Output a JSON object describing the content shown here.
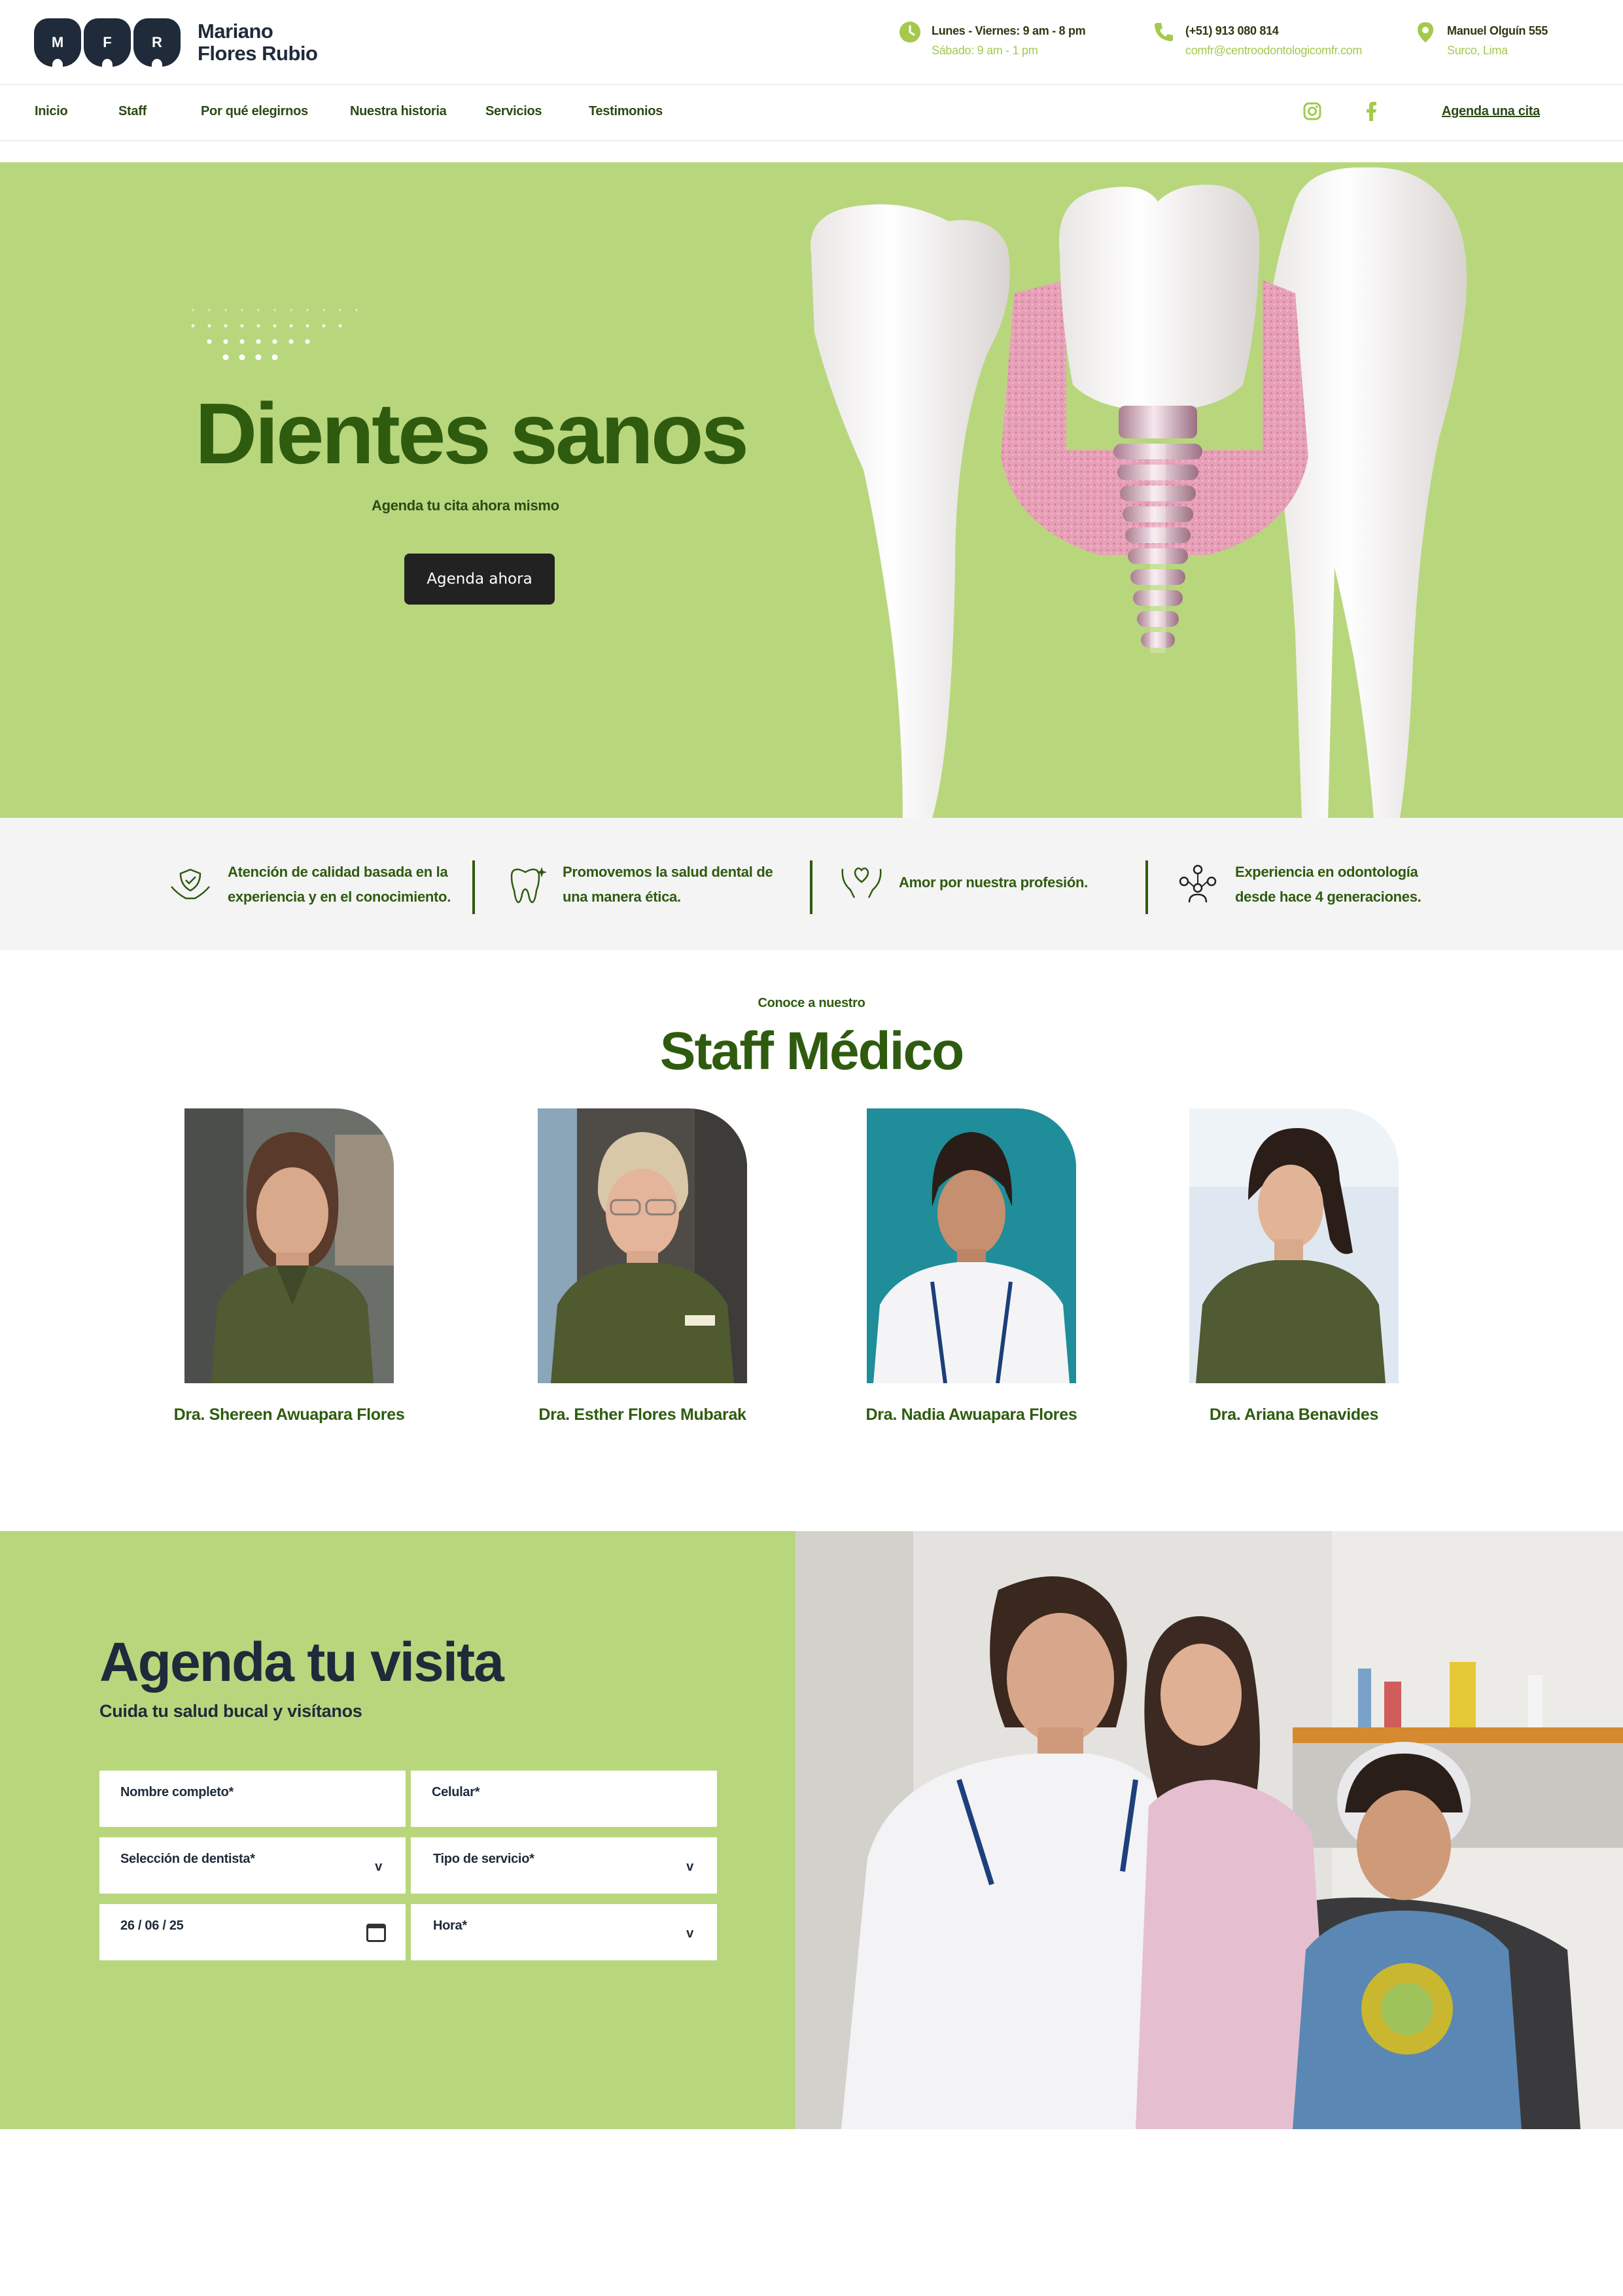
{
  "brand": {
    "letters": [
      "M",
      "F",
      "R"
    ],
    "name_line1": "Mariano",
    "name_line2": "Flores Rubio"
  },
  "contact": {
    "hours": {
      "line1": "Lunes - Viernes: 9 am - 8 pm",
      "line2": "Sábado: 9 am - 1 pm",
      "icon": "clock-icon"
    },
    "phone": {
      "line1": "(+51) 913 080 814",
      "line2": "comfr@centroodontologicomfr.com",
      "icon": "phone-icon"
    },
    "address": {
      "line1": "Manuel Olguín 555",
      "line2": "Surco, Lima",
      "icon": "location-pin-icon"
    }
  },
  "nav": {
    "items": [
      "Inicio",
      "Staff",
      "Por qué elegirnos",
      "Nuestra historia",
      "Servicios",
      "Testimonios"
    ],
    "cta": "Agenda una cita",
    "social": [
      "instagram-icon",
      "facebook-icon"
    ]
  },
  "hero": {
    "title": "Dientes sanos",
    "subtitle": "Agenda tu cita ahora mismo",
    "button": "Agenda ahora"
  },
  "features": [
    {
      "line1": "Atención de calidad basada en la",
      "line2": "experiencia y en el conocimiento.",
      "icon": "hands-shield-icon"
    },
    {
      "line1": "Promovemos la salud dental de",
      "line2": "una manera ética.",
      "icon": "tooth-sparkle-icon"
    },
    {
      "line1": "Amor por nuestra profesión.",
      "line2": "",
      "icon": "hands-heart-icon"
    },
    {
      "line1": "Experiencia en odontología",
      "line2": "desde hace 4 generaciones.",
      "icon": "family-tree-icon"
    }
  ],
  "staff": {
    "eyebrow": "Conoce a nuestro",
    "title": "Staff Médico",
    "doctors": [
      "Dra. Shereen Awuapara Flores",
      "Dra. Esther Flores Mubarak",
      "Dra. Nadia Awuapara Flores",
      "Dra. Ariana Benavides"
    ]
  },
  "booking": {
    "title": "Agenda tu visita",
    "subtitle": "Cuida tu salud bucal y visítanos",
    "fields": {
      "name": "Nombre completo*",
      "phone": "Celular*",
      "dentist": "Selección de dentista*",
      "service": "Tipo de servicio*",
      "date": "26 / 06 / 25",
      "time": "Hora*"
    },
    "select_arrow": "v"
  },
  "colors": {
    "accent_green": "#b8d77d",
    "dark_green": "#2f5b0f",
    "navy": "#1f2b3a",
    "lime": "#a4c94d"
  }
}
